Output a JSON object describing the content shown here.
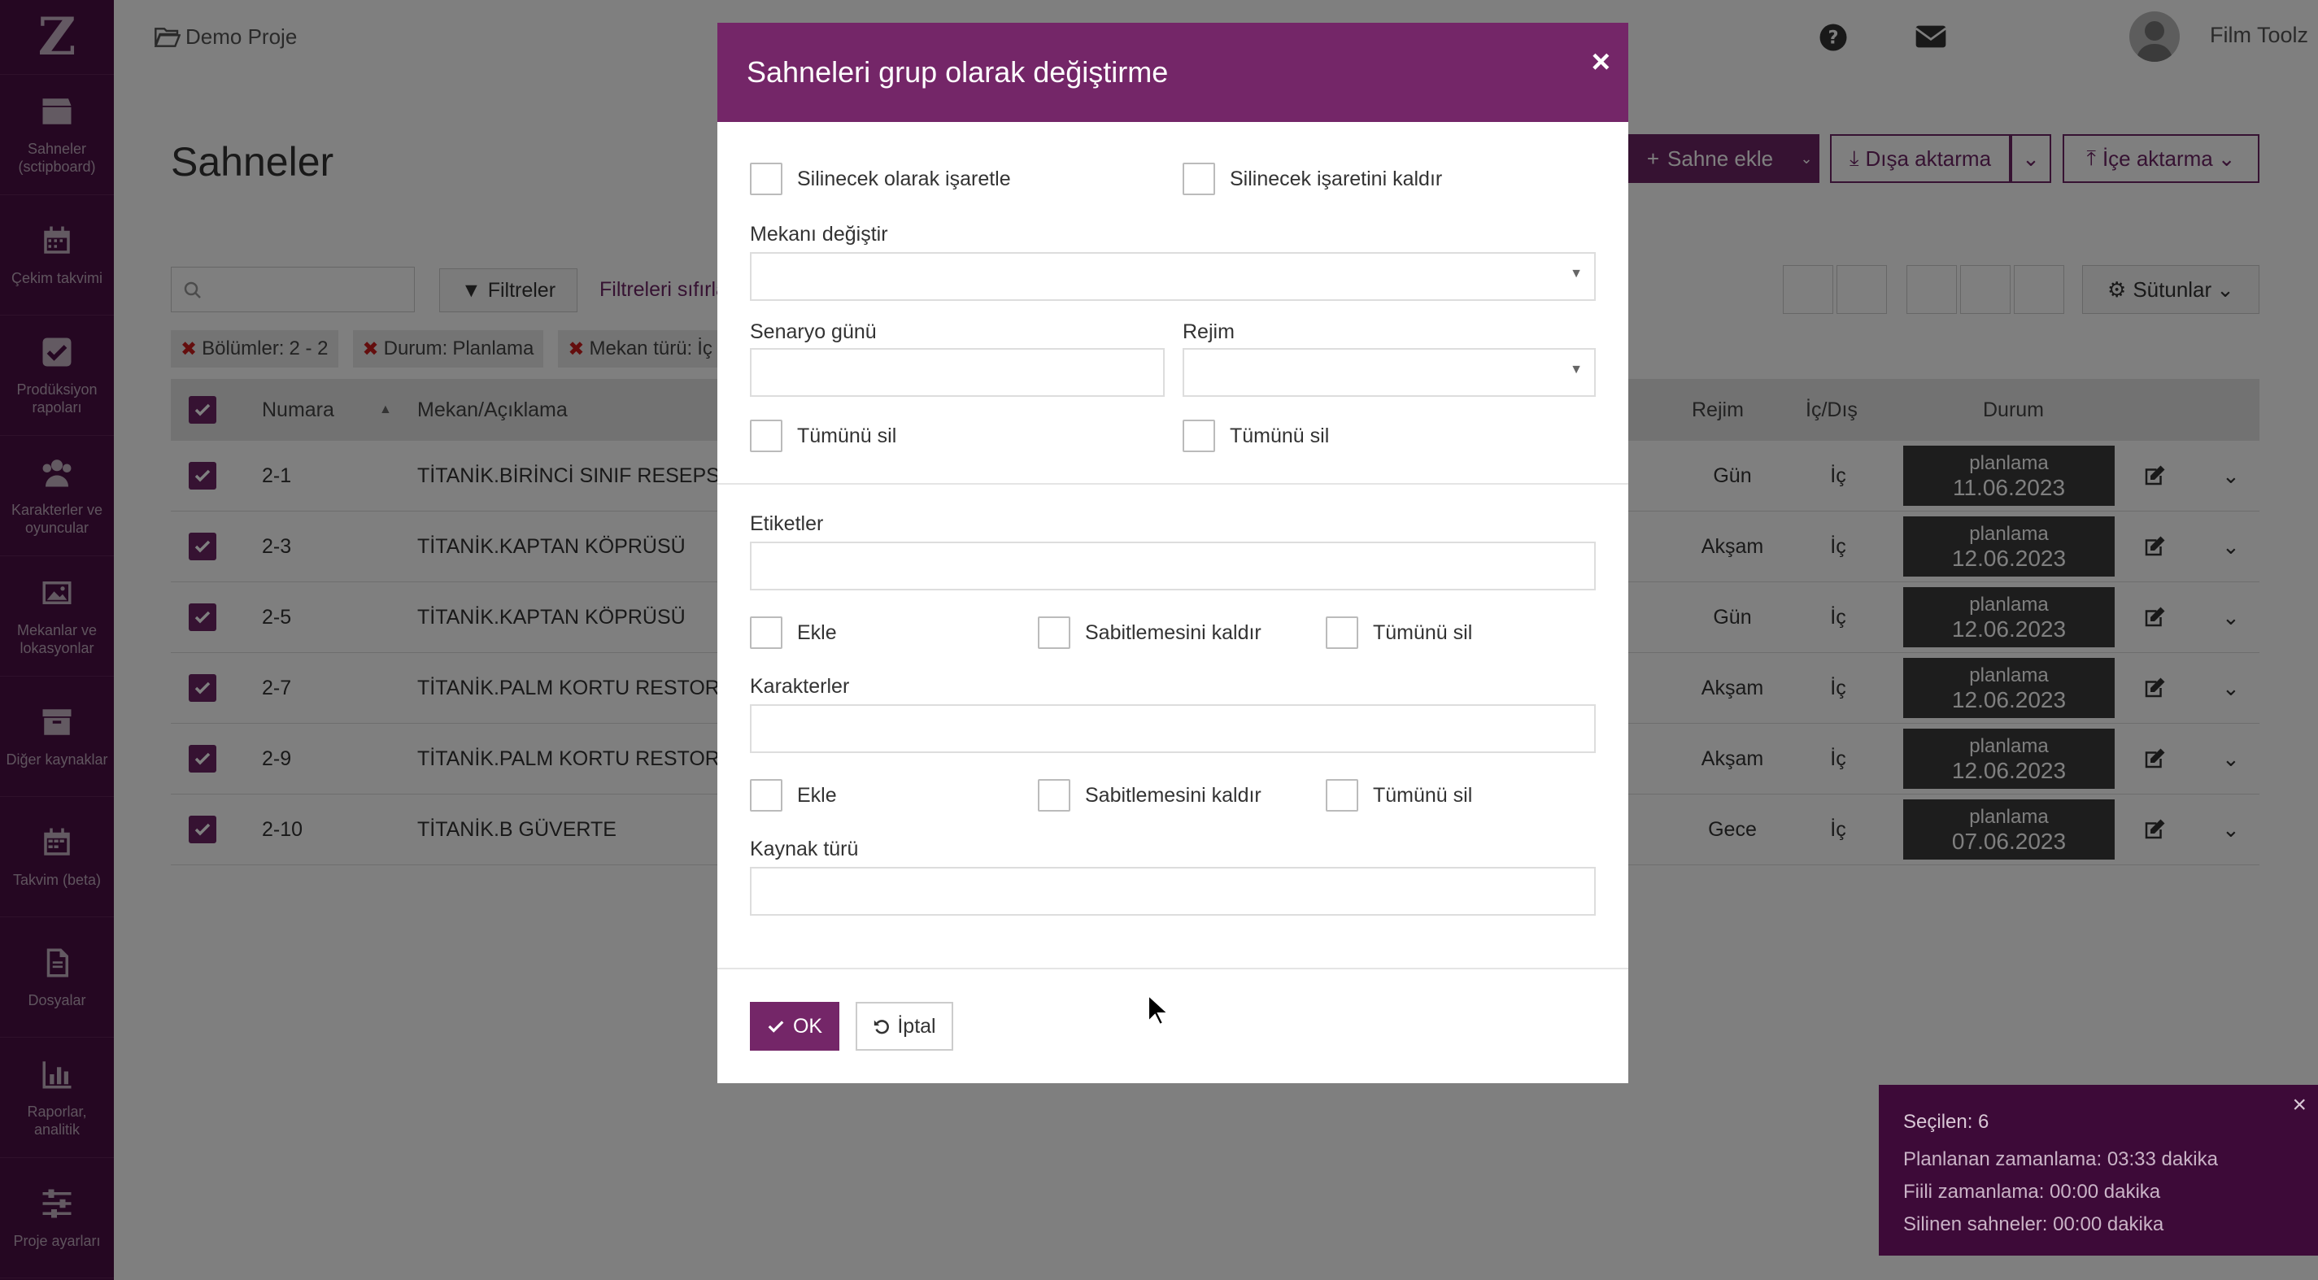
{
  "app": {
    "logo_letter": "Z",
    "project_name": "Demo Proje",
    "user_name": "Film Toolz",
    "language": "TR"
  },
  "sidebar": {
    "items": [
      {
        "label": "Sahneler (sctipboard)",
        "icon": "clapperboard-icon"
      },
      {
        "label": "Çekim takvimi",
        "icon": "calendar-icon"
      },
      {
        "label": "Prodüksiyon rapoları",
        "icon": "checkbox-icon"
      },
      {
        "label": "Karakterler ve oyuncular",
        "icon": "users-icon"
      },
      {
        "label": "Mekanlar ve lokasyonlar",
        "icon": "image-icon"
      },
      {
        "label": "Diğer kaynaklar",
        "icon": "archive-icon"
      },
      {
        "label": "Takvim (beta)",
        "icon": "calendar-grid-icon"
      },
      {
        "label": "Dosyalar",
        "icon": "file-icon"
      },
      {
        "label": "Raporlar, analitik",
        "icon": "bar-chart-icon"
      },
      {
        "label": "Proje ayarları",
        "icon": "sliders-icon"
      }
    ]
  },
  "main": {
    "title": "Sahneler",
    "add_scene": "Sahne ekle",
    "export": "Dışa aktarma",
    "import": "İçe aktarma",
    "filters": "Filtreler",
    "reset_filters": "Filtreleri sıfırla",
    "columns": "Sütunlar",
    "chips": [
      {
        "label": "Bölümler:",
        "value": "2 - 2"
      },
      {
        "label": "Durum:",
        "value": "Planlama"
      },
      {
        "label": "Mekan türü:",
        "value": "İç"
      }
    ],
    "table": {
      "headers": {
        "number": "Numara",
        "location": "Mekan/Açıklama",
        "regime": "Rejim",
        "in_out": "İç/Dış",
        "status": "Durum"
      },
      "rows": [
        {
          "number": "2-1",
          "location": "TİTANİK.BİRİNCİ SINIF RESEPSİYON",
          "regime": "Gün",
          "in_out": "İç",
          "status": "planlama",
          "date": "11.06.2023"
        },
        {
          "number": "2-3",
          "location": "TİTANİK.KAPTAN KÖPRÜSÜ",
          "regime": "Akşam",
          "in_out": "İç",
          "status": "planlama",
          "date": "12.06.2023"
        },
        {
          "number": "2-5",
          "location": "TİTANİK.KAPTAN KÖPRÜSÜ",
          "regime": "Gün",
          "in_out": "İç",
          "status": "planlama",
          "date": "12.06.2023"
        },
        {
          "number": "2-7",
          "location": "TİTANİK.PALM KORTU RESTORAN",
          "regime": "Akşam",
          "in_out": "İç",
          "status": "planlama",
          "date": "12.06.2023"
        },
        {
          "number": "2-9",
          "location": "TİTANİK.PALM KORTU RESTORAN",
          "regime": "Akşam",
          "in_out": "İç",
          "status": "planlama",
          "date": "12.06.2023"
        },
        {
          "number": "2-10",
          "location": "TİTANİK.B GÜVERTE",
          "regime": "Gece",
          "in_out": "İç",
          "status": "planlama",
          "date": "07.06.2023"
        }
      ]
    }
  },
  "modal": {
    "title": "Sahneleri grup olarak değiştirme",
    "mark_delete": "Silinecek olarak işaretle",
    "unmark_delete": "Silinecek işaretini kaldır",
    "change_location": "Mekanı değiştir",
    "script_day": "Senaryo günü",
    "regime": "Rejim",
    "clear_all": "Tümünü sil",
    "tags": "Etiketler",
    "add": "Ekle",
    "unpin": "Sabitlemesini kaldır",
    "characters": "Karakterler",
    "resource_type": "Kaynak türü",
    "ok": "OK",
    "cancel": "İptal"
  },
  "selection": {
    "selected": "Seçilen: 6",
    "planned": "Planlanan zamanlama: 03:33 dakika",
    "actual": "Fiili zamanlama: 00:00 dakika",
    "deleted": "Silinen sahneler: 00:00 dakika"
  },
  "colors": {
    "brand": "#742668",
    "sidebar": "#4b0f44",
    "status_bg": "#3a3a3a"
  }
}
